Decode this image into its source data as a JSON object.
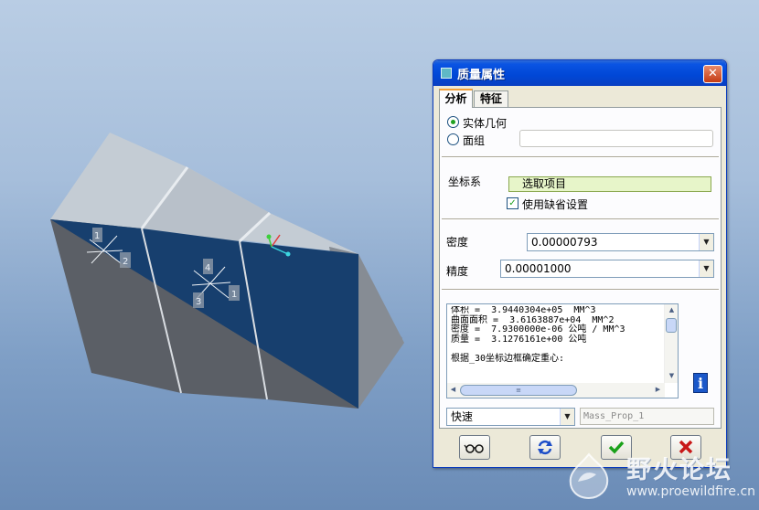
{
  "dialog": {
    "title": "质量属性",
    "close_glyph": "✕",
    "tabs": [
      {
        "label": "分析",
        "active": true
      },
      {
        "label": "特征",
        "active": false
      }
    ],
    "geometry_options": [
      {
        "label": "实体几何",
        "selected": true
      },
      {
        "label": "面组",
        "selected": false
      }
    ],
    "quilt_value": "",
    "csys": {
      "label": "坐标系",
      "select_prompt": "选取项目",
      "use_default_label": "使用缺省设置",
      "use_default_checked": true
    },
    "density": {
      "label": "密度",
      "value": "0.00000793"
    },
    "accuracy": {
      "label": "精度",
      "value": "0.00001000"
    },
    "results": {
      "lines": [
        "体积 =  3.9440304e+05  MM^3",
        "曲面面积 =  3.6163887e+04  MM^2",
        "密度 =  7.9300000e-06 公吨 / MM^3",
        "质量 =  3.1276161e+00 公吨",
        "",
        "根据_30坐标边框确定重心:"
      ],
      "text": ""
    },
    "mode": {
      "value": "快速"
    },
    "name_field": {
      "value": "Mass_Prop_1"
    },
    "toolbar": [
      {
        "icon": "glasses-icon"
      },
      {
        "icon": "refresh-icon"
      },
      {
        "icon": "check-icon"
      },
      {
        "icon": "cancel-icon"
      }
    ]
  },
  "viewport": {
    "datum_labels": [
      "1",
      "2",
      "4",
      "3",
      "1"
    ]
  },
  "watermark": {
    "title": "野火论坛",
    "url": "www.proewildfire.cn"
  },
  "colors": {
    "title_bar": "#0a54e3",
    "dialog_bg": "#ece9d8",
    "model_front": "#173f6e",
    "model_top": "#c3cbd3",
    "model_dark": "#5b5f66",
    "select_item_bg": "#e7f5c9"
  }
}
